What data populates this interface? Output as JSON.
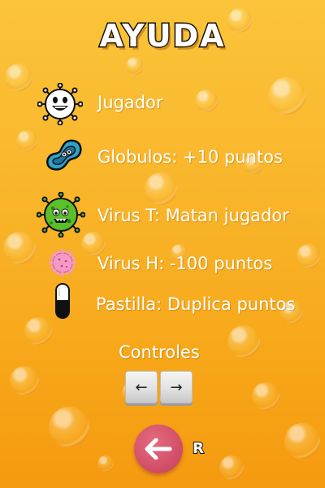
{
  "screen": {
    "title": "AYUDA",
    "background_color": "#f9b52a"
  },
  "legend": [
    {
      "icon": "white-germ-player-icon",
      "label": "Jugador"
    },
    {
      "icon": "blue-blood-cell-icon",
      "label": "Globulos: +10 puntos"
    },
    {
      "icon": "green-virus-icon",
      "label": "Virus T: Matan jugador"
    },
    {
      "icon": "pink-virus-icon",
      "label": "Virus H: -100 puntos"
    },
    {
      "icon": "pill-icon",
      "label": "Pastilla: Duplica puntos"
    }
  ],
  "controls": {
    "label": "Controles",
    "left_key": "←",
    "right_key": "→"
  },
  "back": {
    "icon": "back-arrow-icon",
    "key_hint": "R",
    "button_color": "#d4506a"
  }
}
